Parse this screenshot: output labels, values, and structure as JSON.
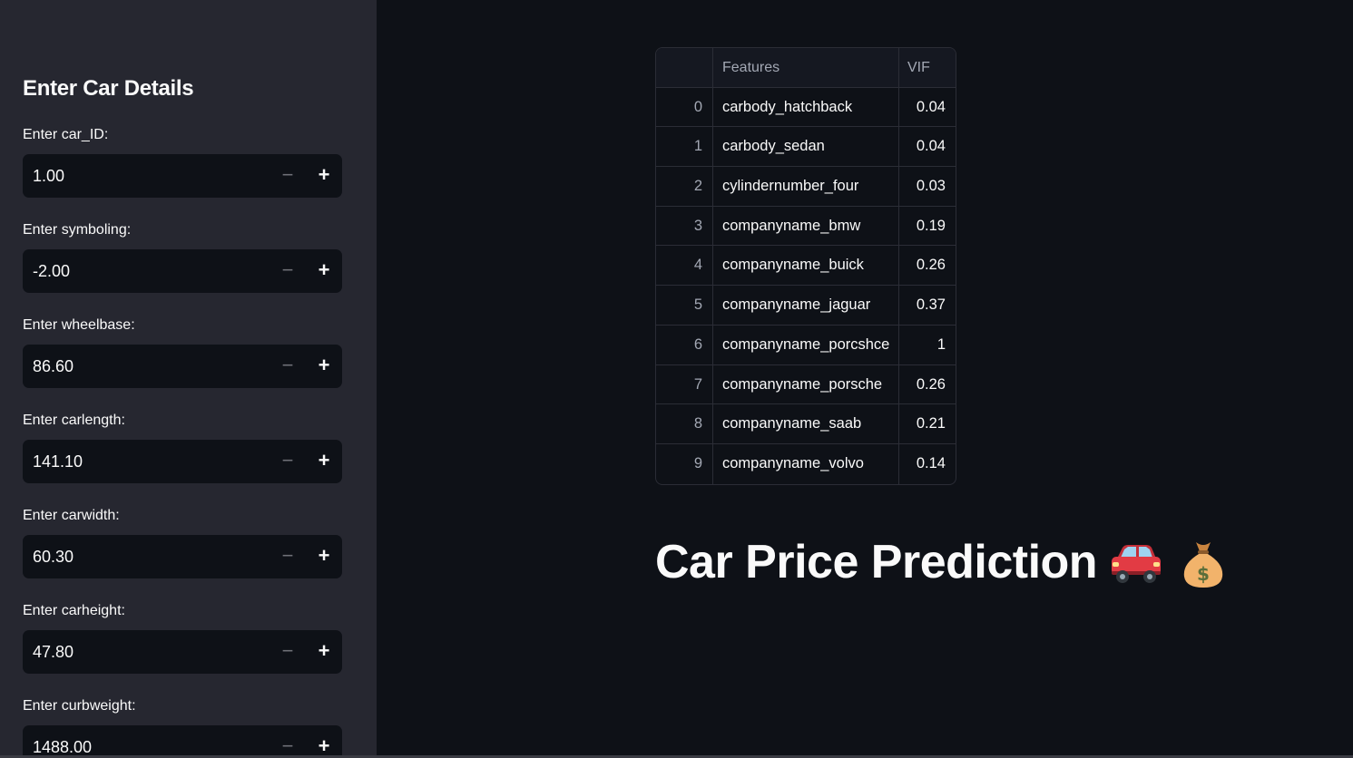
{
  "sidebar": {
    "header": "Enter Car Details",
    "fields": [
      {
        "label": "Enter car_ID:",
        "value": "1.00"
      },
      {
        "label": "Enter symboling:",
        "value": "-2.00"
      },
      {
        "label": "Enter wheelbase:",
        "value": "86.60"
      },
      {
        "label": "Enter carlength:",
        "value": "141.10"
      },
      {
        "label": "Enter carwidth:",
        "value": "60.30"
      },
      {
        "label": "Enter carheight:",
        "value": "47.80"
      },
      {
        "label": "Enter curbweight:",
        "value": "1488.00"
      }
    ],
    "minus_symbol": "−",
    "plus_symbol": "+"
  },
  "vif_table": {
    "columns": [
      "",
      "Features",
      "VIF"
    ],
    "rows": [
      {
        "index": "0",
        "feature": "carbody_hatchback",
        "vif": "0.04"
      },
      {
        "index": "1",
        "feature": "carbody_sedan",
        "vif": "0.04"
      },
      {
        "index": "2",
        "feature": "cylindernumber_four",
        "vif": "0.03"
      },
      {
        "index": "3",
        "feature": "companyname_bmw",
        "vif": "0.19"
      },
      {
        "index": "4",
        "feature": "companyname_buick",
        "vif": "0.26"
      },
      {
        "index": "5",
        "feature": "companyname_jaguar",
        "vif": "0.37"
      },
      {
        "index": "6",
        "feature": "companyname_porcshce",
        "vif": "1"
      },
      {
        "index": "7",
        "feature": "companyname_porsche",
        "vif": "0.26"
      },
      {
        "index": "8",
        "feature": "companyname_saab",
        "vif": "0.21"
      },
      {
        "index": "9",
        "feature": "companyname_volvo",
        "vif": "0.14"
      }
    ]
  },
  "main": {
    "title": "Car Price Prediction",
    "icons": [
      "car-icon",
      "money-bag-icon"
    ]
  },
  "colors": {
    "app_background": "#0e1117",
    "sidebar_background": "#262730",
    "car_red": "#e23b44",
    "money_bag": "#f2b36b"
  }
}
